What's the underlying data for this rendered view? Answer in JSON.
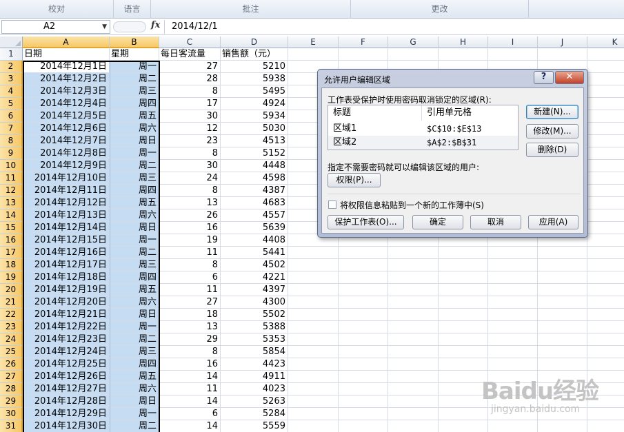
{
  "ribbon": {
    "groups": [
      "校对",
      "语言",
      "批注",
      "更改"
    ]
  },
  "formula_bar": {
    "name_box": "A2",
    "fx": "fx",
    "content": "2014/12/1"
  },
  "columns": [
    "A",
    "B",
    "C",
    "D",
    "E",
    "F",
    "G",
    "H",
    "I",
    "J",
    "K"
  ],
  "header_row": {
    "row": "1",
    "A": "日期",
    "B": "星期",
    "C": "每日客流量",
    "D": "销售额（元）"
  },
  "rows": [
    {
      "n": "2",
      "date": "2014年12月1日",
      "week": "周一",
      "traffic": "27",
      "sales": "5210"
    },
    {
      "n": "3",
      "date": "2014年12月2日",
      "week": "周二",
      "traffic": "28",
      "sales": "5938"
    },
    {
      "n": "4",
      "date": "2014年12月3日",
      "week": "周三",
      "traffic": "8",
      "sales": "5495"
    },
    {
      "n": "5",
      "date": "2014年12月4日",
      "week": "周四",
      "traffic": "17",
      "sales": "4924"
    },
    {
      "n": "6",
      "date": "2014年12月5日",
      "week": "周五",
      "traffic": "30",
      "sales": "5934"
    },
    {
      "n": "7",
      "date": "2014年12月6日",
      "week": "周六",
      "traffic": "12",
      "sales": "5030"
    },
    {
      "n": "8",
      "date": "2014年12月7日",
      "week": "周日",
      "traffic": "23",
      "sales": "4513"
    },
    {
      "n": "9",
      "date": "2014年12月8日",
      "week": "周一",
      "traffic": "8",
      "sales": "5152"
    },
    {
      "n": "10",
      "date": "2014年12月9日",
      "week": "周二",
      "traffic": "30",
      "sales": "4448"
    },
    {
      "n": "11",
      "date": "2014年12月10日",
      "week": "周三",
      "traffic": "24",
      "sales": "4598"
    },
    {
      "n": "12",
      "date": "2014年12月11日",
      "week": "周四",
      "traffic": "8",
      "sales": "4387"
    },
    {
      "n": "13",
      "date": "2014年12月12日",
      "week": "周五",
      "traffic": "13",
      "sales": "4683"
    },
    {
      "n": "14",
      "date": "2014年12月13日",
      "week": "周六",
      "traffic": "26",
      "sales": "4557"
    },
    {
      "n": "15",
      "date": "2014年12月14日",
      "week": "周日",
      "traffic": "16",
      "sales": "5639"
    },
    {
      "n": "16",
      "date": "2014年12月15日",
      "week": "周一",
      "traffic": "19",
      "sales": "4408"
    },
    {
      "n": "17",
      "date": "2014年12月16日",
      "week": "周二",
      "traffic": "11",
      "sales": "5441"
    },
    {
      "n": "18",
      "date": "2014年12月17日",
      "week": "周三",
      "traffic": "8",
      "sales": "4502"
    },
    {
      "n": "19",
      "date": "2014年12月18日",
      "week": "周四",
      "traffic": "6",
      "sales": "4221"
    },
    {
      "n": "20",
      "date": "2014年12月19日",
      "week": "周五",
      "traffic": "11",
      "sales": "4397"
    },
    {
      "n": "21",
      "date": "2014年12月20日",
      "week": "周六",
      "traffic": "27",
      "sales": "4300"
    },
    {
      "n": "22",
      "date": "2014年12月21日",
      "week": "周日",
      "traffic": "18",
      "sales": "5502"
    },
    {
      "n": "23",
      "date": "2014年12月22日",
      "week": "周一",
      "traffic": "13",
      "sales": "5388"
    },
    {
      "n": "24",
      "date": "2014年12月23日",
      "week": "周二",
      "traffic": "29",
      "sales": "5353"
    },
    {
      "n": "25",
      "date": "2014年12月24日",
      "week": "周三",
      "traffic": "8",
      "sales": "5854"
    },
    {
      "n": "26",
      "date": "2014年12月25日",
      "week": "周四",
      "traffic": "16",
      "sales": "4423"
    },
    {
      "n": "27",
      "date": "2014年12月26日",
      "week": "周五",
      "traffic": "14",
      "sales": "4911"
    },
    {
      "n": "28",
      "date": "2014年12月27日",
      "week": "周六",
      "traffic": "11",
      "sales": "4023"
    },
    {
      "n": "29",
      "date": "2014年12月28日",
      "week": "周日",
      "traffic": "14",
      "sales": "5263"
    },
    {
      "n": "30",
      "date": "2014年12月29日",
      "week": "周一",
      "traffic": "6",
      "sales": "5284"
    },
    {
      "n": "31",
      "date": "2014年12月30日",
      "week": "周二",
      "traffic": "14",
      "sales": "5559"
    }
  ],
  "dialog": {
    "title": "允许用户编辑区域",
    "help": "?",
    "close": "✕",
    "ranges_label": "工作表受保护时使用密码取消锁定的区域(R):",
    "list_headers": [
      "标题",
      "引用单元格"
    ],
    "ranges": [
      {
        "title": "区域1",
        "ref": "$C$10:$E$13"
      },
      {
        "title": "区域2",
        "ref": "$A$2:$B$31"
      }
    ],
    "new_button": "新建(N)...",
    "modify_button": "修改(M)...",
    "delete_button": "删除(D)",
    "users_label": "指定不需要密码就可以编辑该区域的用户:",
    "permissions_button": "权限(P)...",
    "paste_label": "将权限信息粘贴到一个新的工作薄中(S)",
    "protect_button": "保护工作表(O)...",
    "ok_button": "确定",
    "cancel_button": "取消",
    "apply_button": "应用(A)"
  },
  "watermark": {
    "main": "Baidu经验",
    "sub": "jingyan.baidu.com"
  },
  "colors": {
    "selection": "#c5dcf3",
    "header_selected": "#f7c867"
  }
}
